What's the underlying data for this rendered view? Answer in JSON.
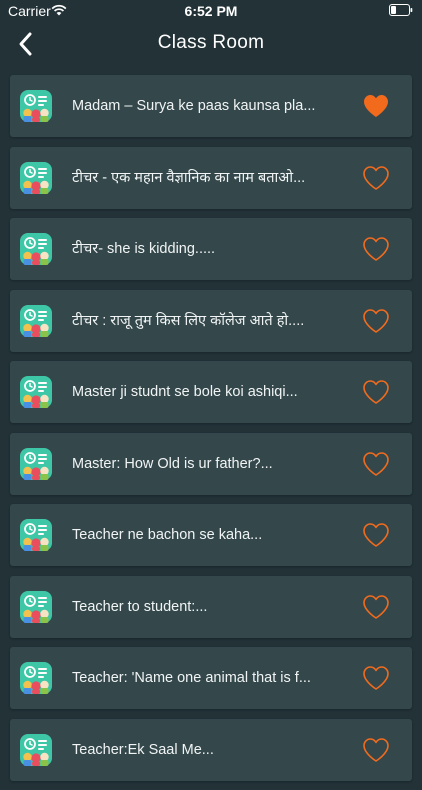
{
  "status_bar": {
    "carrier": "Carrier",
    "time": "6:52 PM"
  },
  "nav": {
    "title": "Class Room"
  },
  "colors": {
    "background": "#223237",
    "card": "#34484c",
    "heart_orange": "#f26b1d",
    "icon_teal": "#3ec7a6"
  },
  "items": [
    {
      "text": "Madam – Surya ke paas kaunsa pla...",
      "favorite": true
    },
    {
      "text": "टीचर - एक महान वैज्ञानिक का नाम बताओ...",
      "favorite": false
    },
    {
      "text": "टीचर- she is kidding.....",
      "favorite": false
    },
    {
      "text": "टीचर : राजू तुम किस लिए कॉलेज आते हो....",
      "favorite": false
    },
    {
      "text": "Master ji studnt se bole koi ashiqi...",
      "favorite": false
    },
    {
      "text": "Master: How Old is ur father?...",
      "favorite": false
    },
    {
      "text": "Teacher ne bachon se kaha...",
      "favorite": false
    },
    {
      "text": "Teacher to student:...",
      "favorite": false
    },
    {
      "text": "Teacher: 'Name one animal that is f...",
      "favorite": false
    },
    {
      "text": "Teacher:Ek Saal Me...",
      "favorite": false
    }
  ]
}
